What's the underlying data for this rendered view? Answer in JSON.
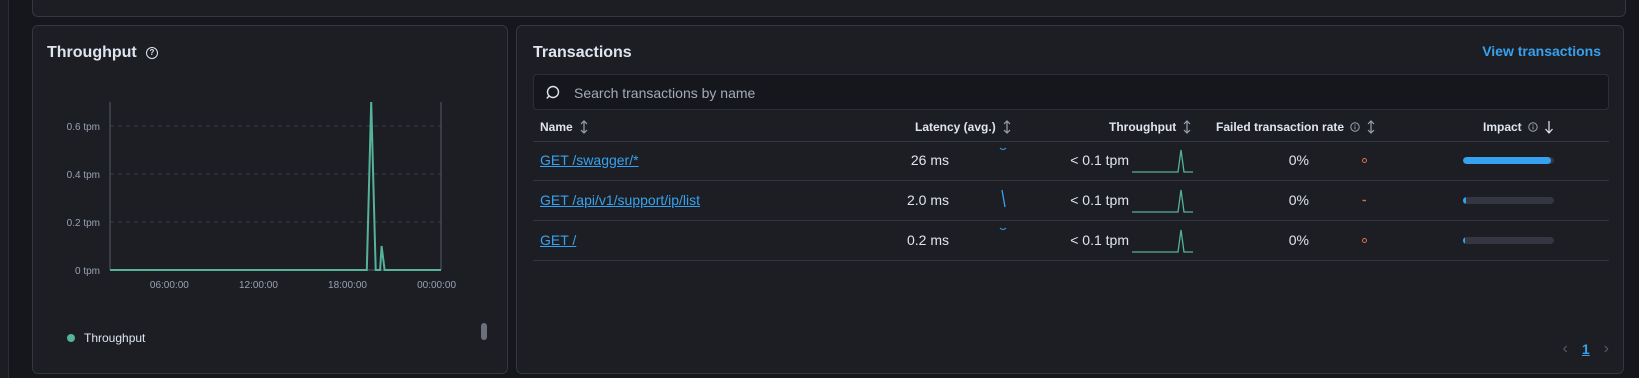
{
  "throughput_panel": {
    "title": "Throughput",
    "legend_label": "Throughput",
    "chart_data": {
      "type": "line",
      "title": "Throughput",
      "ylabel": "",
      "xlabel": "",
      "y_ticks": [
        "0 tpm",
        "0.2 tpm",
        "0.4 tpm",
        "0.6 tpm"
      ],
      "y_tick_values": [
        0,
        0.2,
        0.4,
        0.6
      ],
      "x_ticks": [
        "06:00:00",
        "12:00:00",
        "18:00:00",
        "00:00:00"
      ],
      "x_tick_hours": [
        6,
        12,
        18,
        24
      ],
      "ylim": [
        0,
        0.7
      ],
      "xlim_hours": [
        2,
        24.3
      ],
      "grid": true,
      "series": [
        {
          "name": "Throughput",
          "color": "#54b399",
          "x_hours": [
            2,
            19.3,
            19.6,
            19.9,
            20.2,
            20.3,
            20.5,
            20.8,
            24.3
          ],
          "values": [
            0,
            0,
            0.7,
            0,
            0,
            0.1,
            0,
            0,
            0
          ]
        }
      ]
    }
  },
  "transactions_panel": {
    "title": "Transactions",
    "view_link": "View transactions",
    "search_placeholder": "Search transactions by name",
    "columns": {
      "name": "Name",
      "latency": "Latency (avg.)",
      "throughput": "Throughput",
      "failed": "Failed transaction rate",
      "impact": "Impact"
    },
    "rows": [
      {
        "name": "GET /swagger/*",
        "latency": "26 ms",
        "throughput": "< 0.1 tpm",
        "failed_rate": "0%",
        "impact": 0.97
      },
      {
        "name": "GET /api/v1/support/ip/list",
        "latency": "2.0 ms",
        "throughput": "< 0.1 tpm",
        "failed_rate": "0%",
        "impact": 0.03
      },
      {
        "name": "GET /",
        "latency": "0.2 ms",
        "throughput": "< 0.1 tpm",
        "failed_rate": "0%",
        "impact": 0.01
      }
    ],
    "pagination": {
      "current_page": "1"
    },
    "colors": {
      "link": "#36a2ef",
      "sparkline": "#54b399",
      "failed_marker": "#e7664c"
    }
  }
}
